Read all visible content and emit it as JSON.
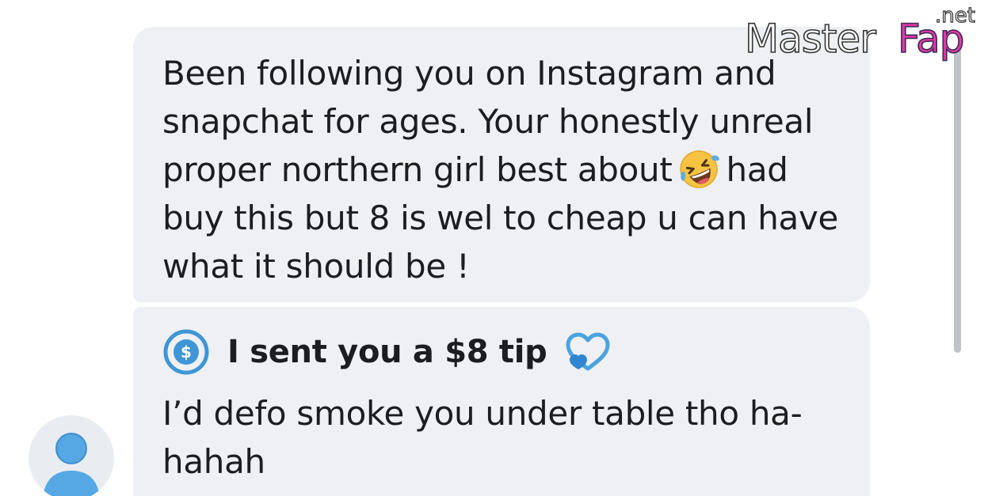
{
  "messages": [
    {
      "text_before_emoji": "Been following you on Instagram and\nsnapchat for ages. Your honestly unreal\nproper northern girl best about",
      "emoji": "rolling-on-the-floor-laughing-emoji",
      "text_after_emoji": "had\nbuy this but 8 is wel to cheap u can have\nwhat it should be !"
    },
    {
      "tip": {
        "icon": "dollar-circle-icon",
        "label": "I sent you a $8 tip",
        "heart_icon": "heart-icon"
      },
      "text": "I’d defo smoke you under table tho ha-\nhahah"
    }
  ],
  "watermark": {
    "brand_part_1": "Master",
    "brand_part_2": "Fap",
    "tld": ".net"
  },
  "colors": {
    "bubble_background": "#eef0f3",
    "text": "#1b1d21",
    "tip_accent": "#3f95d6",
    "avatar_blue": "#55a8e4",
    "watermark_pink": "#e23aa6"
  }
}
